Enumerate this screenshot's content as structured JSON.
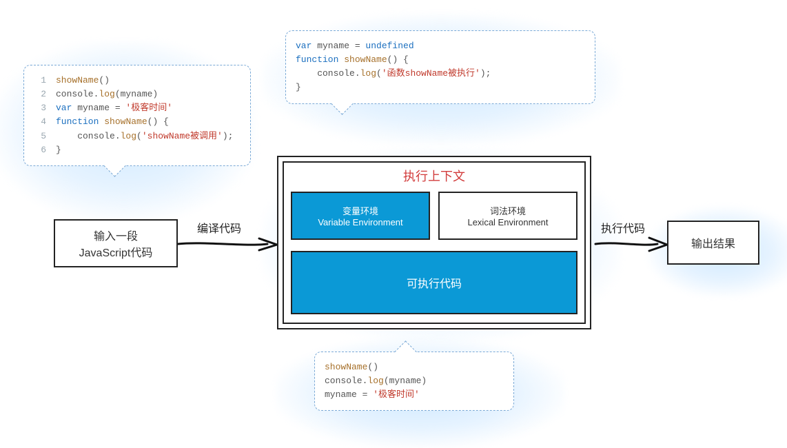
{
  "code_left": {
    "lines": [
      {
        "n": "1",
        "segs": [
          [
            "fn",
            "showName"
          ],
          [
            "plain",
            "()"
          ]
        ]
      },
      {
        "n": "2",
        "segs": [
          [
            "plain",
            "console."
          ],
          [
            "fn",
            "log"
          ],
          [
            "plain",
            "(myname)"
          ]
        ]
      },
      {
        "n": "3",
        "segs": [
          [
            "kw",
            "var"
          ],
          [
            "plain",
            " myname = "
          ],
          [
            "str",
            "'极客时间'"
          ]
        ]
      },
      {
        "n": "4",
        "segs": [
          [
            "kw",
            "function"
          ],
          [
            "plain",
            " "
          ],
          [
            "fn",
            "showName"
          ],
          [
            "plain",
            "() {"
          ]
        ]
      },
      {
        "n": "5",
        "segs": [
          [
            "plain",
            "    console."
          ],
          [
            "fn",
            "log"
          ],
          [
            "plain",
            "("
          ],
          [
            "str",
            "'showName被调用'"
          ],
          [
            "plain",
            ");"
          ]
        ]
      },
      {
        "n": "6",
        "segs": [
          [
            "plain",
            "}"
          ]
        ]
      }
    ]
  },
  "code_top": {
    "lines": [
      {
        "segs": [
          [
            "kw",
            "var"
          ],
          [
            "plain",
            " myname = "
          ],
          [
            "kw",
            "undefined"
          ]
        ]
      },
      {
        "segs": [
          [
            "kw",
            "function"
          ],
          [
            "plain",
            " "
          ],
          [
            "fn",
            "showName"
          ],
          [
            "plain",
            "() {"
          ]
        ]
      },
      {
        "segs": [
          [
            "plain",
            "    console."
          ],
          [
            "fn",
            "log"
          ],
          [
            "plain",
            "("
          ],
          [
            "str",
            "'函数showName被执行'"
          ],
          [
            "plain",
            ");"
          ]
        ]
      },
      {
        "segs": [
          [
            "plain",
            "}"
          ]
        ]
      }
    ]
  },
  "code_bottom": {
    "lines": [
      {
        "segs": [
          [
            "fn",
            "showName"
          ],
          [
            "plain",
            "()"
          ]
        ]
      },
      {
        "segs": [
          [
            "plain",
            "console."
          ],
          [
            "fn",
            "log"
          ],
          [
            "plain",
            "(myname)"
          ]
        ]
      },
      {
        "segs": [
          [
            "plain",
            "myname = "
          ],
          [
            "str",
            "'极客时间'"
          ]
        ]
      }
    ]
  },
  "boxes": {
    "input_l1": "输入一段",
    "input_l2": "JavaScript代码",
    "output": "输出结果",
    "ctx_title": "执行上下文",
    "var_env_cn": "变量环境",
    "var_env_en": "Variable Environment",
    "lex_env_cn": "词法环境",
    "lex_env_en": "Lexical Environment",
    "exec_code": "可执行代码"
  },
  "arrows": {
    "compile": "编译代码",
    "run": "执行代码"
  }
}
